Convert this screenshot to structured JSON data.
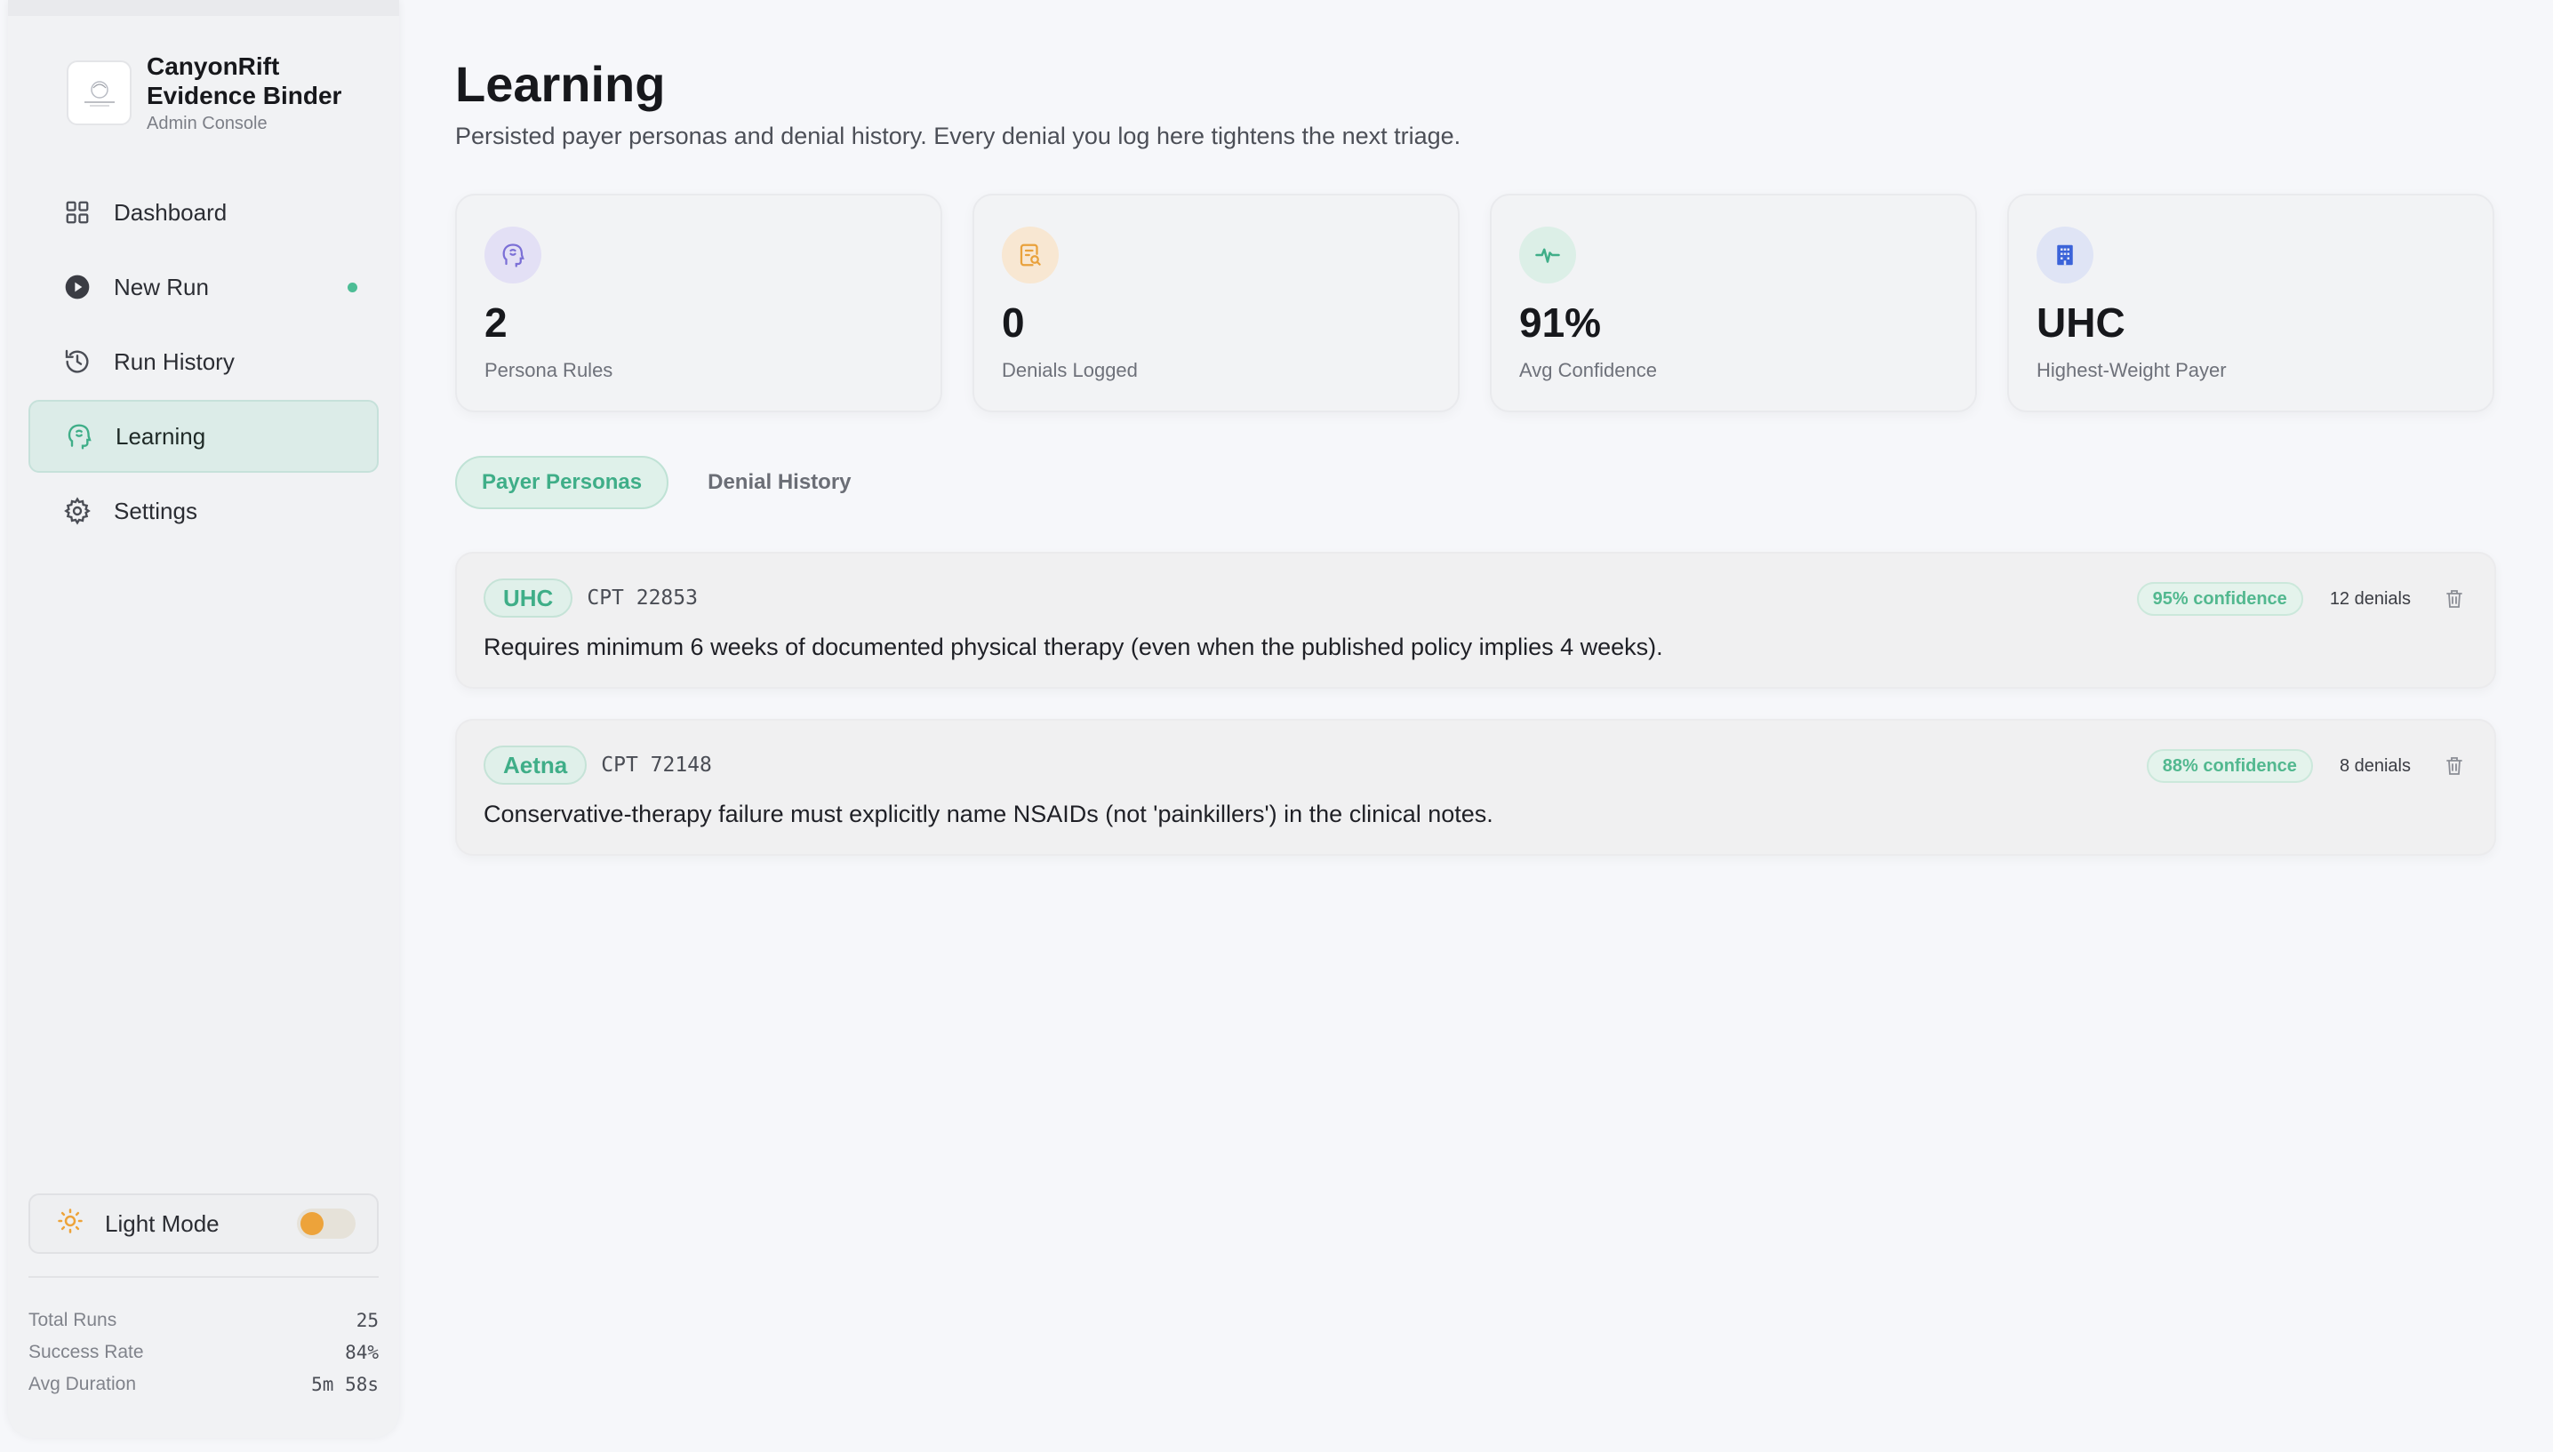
{
  "brand": {
    "title_line1": "CanyonRift",
    "title_line2": "Evidence Binder",
    "subtitle": "Admin Console"
  },
  "sidebar": {
    "items": [
      {
        "label": "Dashboard",
        "icon": "grid-icon"
      },
      {
        "label": "New Run",
        "icon": "play-circle-icon",
        "dot": true
      },
      {
        "label": "Run History",
        "icon": "history-icon"
      },
      {
        "label": "Learning",
        "icon": "brain-head-icon",
        "active": true
      },
      {
        "label": "Settings",
        "icon": "gear-icon"
      }
    ],
    "theme_label": "Light Mode",
    "stats": [
      {
        "label": "Total Runs",
        "value": "25"
      },
      {
        "label": "Success Rate",
        "value": "84%"
      },
      {
        "label": "Avg Duration",
        "value": "5m 58s"
      }
    ]
  },
  "main": {
    "title": "Learning",
    "subtitle": "Persisted payer personas and denial history. Every denial you log here tightens the next triage.",
    "cards": [
      {
        "value": "2",
        "label": "Persona Rules",
        "icon": "brain-head-icon",
        "color": "#7b6fd6"
      },
      {
        "value": "0",
        "label": "Denials Logged",
        "icon": "document-search-icon",
        "color": "#e9a13b"
      },
      {
        "value": "91%",
        "label": "Avg Confidence",
        "icon": "pulse-icon",
        "color": "#3fae88"
      },
      {
        "value": "UHC",
        "label": "Highest-Weight Payer",
        "icon": "building-icon",
        "color": "#3b63d9"
      }
    ],
    "tabs": [
      {
        "label": "Payer Personas",
        "active": true
      },
      {
        "label": "Denial History",
        "active": false
      }
    ],
    "personas": [
      {
        "payer": "UHC",
        "cpt": "CPT 22853",
        "rule": "Requires minimum 6 weeks of documented physical therapy (even when the published policy implies 4 weeks).",
        "confidence": "95% confidence",
        "denials": "12 denials"
      },
      {
        "payer": "Aetna",
        "cpt": "CPT 72148",
        "rule": "Conservative-therapy failure must explicitly name NSAIDs (not 'painkillers') in the clinical notes.",
        "confidence": "88% confidence",
        "denials": "8 denials"
      }
    ]
  },
  "colors": {
    "accent": "#3fae88",
    "toggle_knob": "#eda33a"
  }
}
